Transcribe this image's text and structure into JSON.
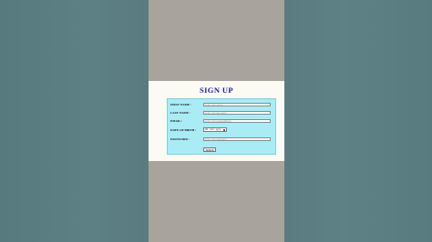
{
  "signup": {
    "title": "SIGN UP",
    "fields": [
      {
        "label": "FIRST NAME :",
        "placeholder": "enter your name"
      },
      {
        "label": "LAST NAME :",
        "placeholder": "enter your last name"
      },
      {
        "label": "EMAIL :",
        "placeholder": "enter your email address"
      },
      {
        "label": "DATE OF BIRTH :",
        "value": "dd - mm - yyyy"
      },
      {
        "label": "PASSWORD :",
        "placeholder": "enter your password"
      }
    ],
    "submit_label": "Submit"
  },
  "colors": {
    "title": "#1a1aa6",
    "form_background": "#a9ecf6",
    "page_background": "#fbfaf3"
  }
}
